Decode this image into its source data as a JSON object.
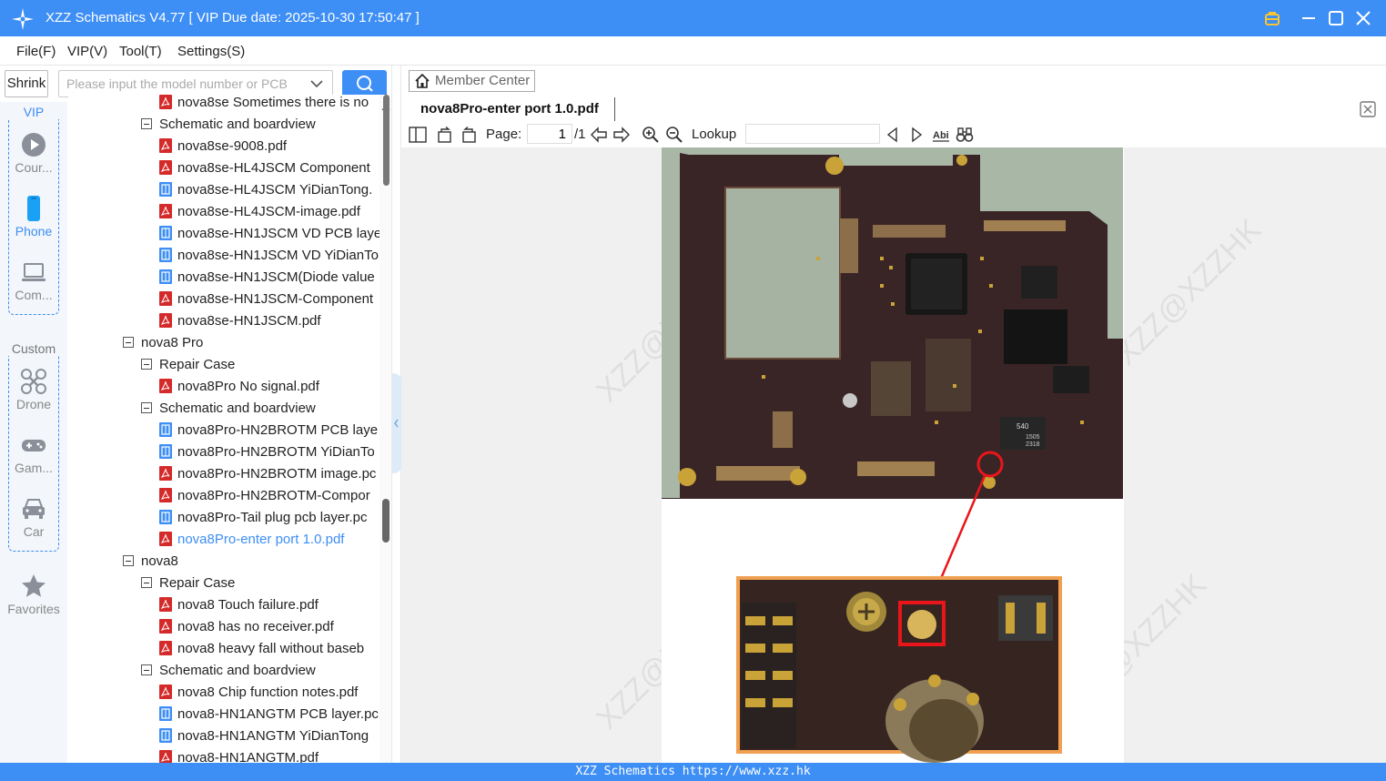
{
  "window": {
    "title": "XZZ Schematics V4.77 [ VIP Due date: 2025-10-30 17:50:47 ]"
  },
  "menu": [
    "File(F)",
    "VIP(V)",
    "Tool(T)",
    "Settings(S)"
  ],
  "search": {
    "shrink_label": "Shrink",
    "placeholder": "Please input the model number or PCB"
  },
  "leftnav": {
    "vip_label": "VIP",
    "custom_label": "Custom",
    "courses": "Cour...",
    "phone": "Phone",
    "computer": "Com...",
    "drone": "Drone",
    "game": "Gam...",
    "car": "Car",
    "favorites": "Favorites"
  },
  "tree": [
    {
      "level": 2,
      "type": "pdf",
      "label": "nova8se Sometimes there is no"
    },
    {
      "level": 1,
      "type": "folder",
      "label": "Schematic and boardview"
    },
    {
      "level": 2,
      "type": "pdf",
      "label": "nova8se-9008.pdf"
    },
    {
      "level": 2,
      "type": "pdf",
      "label": "nova8se-HL4JSCM Component"
    },
    {
      "level": 2,
      "type": "pcb",
      "label": "nova8se-HL4JSCM YiDianTong."
    },
    {
      "level": 2,
      "type": "pdf",
      "label": "nova8se-HL4JSCM-image.pdf"
    },
    {
      "level": 2,
      "type": "pcb",
      "label": "nova8se-HN1JSCM VD PCB laye"
    },
    {
      "level": 2,
      "type": "pcb",
      "label": "nova8se-HN1JSCM VD YiDianTo"
    },
    {
      "level": 2,
      "type": "pcb",
      "label": "nova8se-HN1JSCM(Diode value"
    },
    {
      "level": 2,
      "type": "pdf",
      "label": "nova8se-HN1JSCM-Component"
    },
    {
      "level": 2,
      "type": "pdf",
      "label": "nova8se-HN1JSCM.pdf"
    },
    {
      "level": 0,
      "type": "folder",
      "label": "nova8 Pro"
    },
    {
      "level": 1,
      "type": "folder",
      "label": "Repair Case"
    },
    {
      "level": 2,
      "type": "pdf",
      "label": "nova8Pro No signal.pdf"
    },
    {
      "level": 1,
      "type": "folder",
      "label": "Schematic and boardview"
    },
    {
      "level": 2,
      "type": "pcb",
      "label": "nova8Pro-HN2BROTM PCB laye"
    },
    {
      "level": 2,
      "type": "pcb",
      "label": "nova8Pro-HN2BROTM YiDianTo"
    },
    {
      "level": 2,
      "type": "pdf",
      "label": "nova8Pro-HN2BROTM image.pc"
    },
    {
      "level": 2,
      "type": "pdf",
      "label": "nova8Pro-HN2BROTM-Compor"
    },
    {
      "level": 2,
      "type": "pcb",
      "label": "nova8Pro-Tail plug pcb layer.pc"
    },
    {
      "level": 2,
      "type": "pdf",
      "label": "nova8Pro-enter port 1.0.pdf",
      "selected": true
    },
    {
      "level": 0,
      "type": "folder",
      "label": "nova8"
    },
    {
      "level": 1,
      "type": "folder",
      "label": "Repair Case"
    },
    {
      "level": 2,
      "type": "pdf",
      "label": "nova8 Touch failure.pdf"
    },
    {
      "level": 2,
      "type": "pdf",
      "label": "nova8 has no receiver.pdf"
    },
    {
      "level": 2,
      "type": "pdf",
      "label": "nova8 heavy fall without baseb"
    },
    {
      "level": 1,
      "type": "folder",
      "label": "Schematic and boardview"
    },
    {
      "level": 2,
      "type": "pdf",
      "label": "nova8 Chip function notes.pdf"
    },
    {
      "level": 2,
      "type": "pcb",
      "label": "nova8-HN1ANGTM PCB layer.pc"
    },
    {
      "level": 2,
      "type": "pcb",
      "label": "nova8-HN1ANGTM YiDianTong"
    },
    {
      "level": 2,
      "type": "pdf",
      "label": "nova8-HN1ANGTM.pdf"
    }
  ],
  "viewer": {
    "member_center": "Member Center",
    "doc_tab": "nova8Pro-enter port 1.0.pdf",
    "page_label": "Page:",
    "page_current": "1",
    "page_total": "/1",
    "lookup_label": "Lookup",
    "watermark": "XZZ@XZZHK",
    "chip_label_1": "540",
    "chip_label_2": "1505",
    "chip_label_3": "2318"
  },
  "status": {
    "text": "XZZ Schematics https://www.xzz.hk"
  },
  "colors": {
    "accent": "#3d8ef5",
    "pdf_icon": "#d42a2a",
    "pcb_icon": "#3d8ef5",
    "pcb_board": "#3a2526",
    "highlight": "#e8161b",
    "zoom_frame": "#f0a050"
  }
}
